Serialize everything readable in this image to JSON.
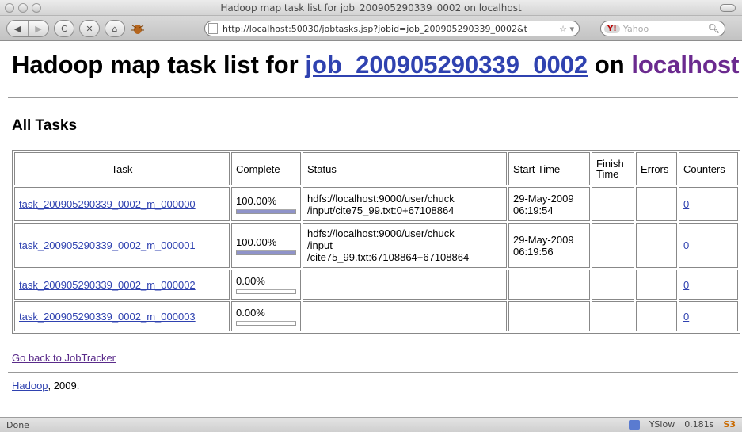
{
  "browser": {
    "window_title": "Hadoop map task list for job_200905290339_0002 on localhost",
    "back_glyph": "◀",
    "forward_glyph": "▶",
    "reload_glyph": "C",
    "stop_glyph": "✕",
    "home_glyph": "⌂",
    "url": "http://localhost:50030/jobtasks.jsp?jobid=job_200905290339_0002&t",
    "search_engine": "Y!",
    "search_placeholder": "Yahoo",
    "status_text": "Done",
    "yslow_label": "YSlow",
    "load_time": "0.181s",
    "s3_label": "S3"
  },
  "page": {
    "title_prefix": "Hadoop map task list for",
    "job_id": "job_200905290339_0002",
    "title_on": "on",
    "host": "localhost",
    "section_heading": "All Tasks",
    "table": {
      "headers": {
        "task": "Task",
        "complete": "Complete",
        "status": "Status",
        "start_time": "Start Time",
        "finish_time": "Finish Time",
        "errors": "Errors",
        "counters": "Counters"
      },
      "rows": [
        {
          "task": "task_200905290339_0002_m_000000",
          "complete": "100.00%",
          "progress": 1.0,
          "status_line1": "hdfs://localhost:9000/user/chuck",
          "status_line2": "/input/cite75_99.txt:0+67108864",
          "status_line3": "",
          "start_line1": "29-May-2009",
          "start_line2": "06:19:54",
          "finish": "",
          "errors": "",
          "counters": "0"
        },
        {
          "task": "task_200905290339_0002_m_000001",
          "complete": "100.00%",
          "progress": 1.0,
          "status_line1": "hdfs://localhost:9000/user/chuck",
          "status_line2": "/input",
          "status_line3": "/cite75_99.txt:67108864+67108864",
          "start_line1": "29-May-2009",
          "start_line2": "06:19:56",
          "finish": "",
          "errors": "",
          "counters": "0"
        },
        {
          "task": "task_200905290339_0002_m_000002",
          "complete": "0.00%",
          "progress": 0.0,
          "status_line1": "",
          "status_line2": "",
          "status_line3": "",
          "start_line1": "",
          "start_line2": "",
          "finish": "",
          "errors": "",
          "counters": "0"
        },
        {
          "task": "task_200905290339_0002_m_000003",
          "complete": "0.00%",
          "progress": 0.0,
          "status_line1": "",
          "status_line2": "",
          "status_line3": "",
          "start_line1": "",
          "start_line2": "",
          "finish": "",
          "errors": "",
          "counters": "0"
        }
      ]
    },
    "go_back_link": "Go back to JobTracker",
    "footer_link": "Hadoop",
    "footer_suffix": ", 2009."
  },
  "colors": {
    "link": "#2f42b0",
    "visited": "#6b2a8f",
    "progress_fill": "#8f93c9"
  }
}
